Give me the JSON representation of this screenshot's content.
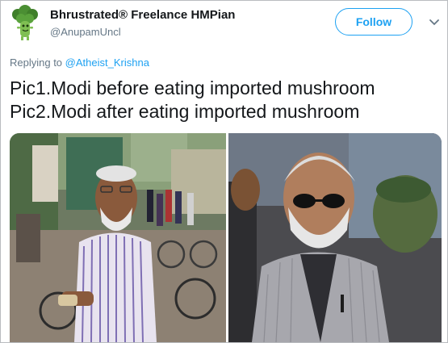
{
  "author": {
    "display_name": "Bhrustrated® Freelance HMPian",
    "handle": "@AnupamUncl",
    "avatar_icon": "broccoli-avatar-icon"
  },
  "header": {
    "follow_label": "Follow",
    "menu_icon": "chevron-down-icon"
  },
  "reply": {
    "prefix": "Replying to",
    "mention": "@Atheist_Krishna"
  },
  "tweet": {
    "line1": "Pic1.Modi before eating imported mushroom",
    "line2": "Pic2.Modi after eating imported mushroom"
  },
  "media": {
    "photos": [
      "photo-before",
      "photo-after"
    ]
  },
  "colors": {
    "accent": "#1da1f2",
    "text": "#14171a",
    "secondary": "#657786"
  }
}
